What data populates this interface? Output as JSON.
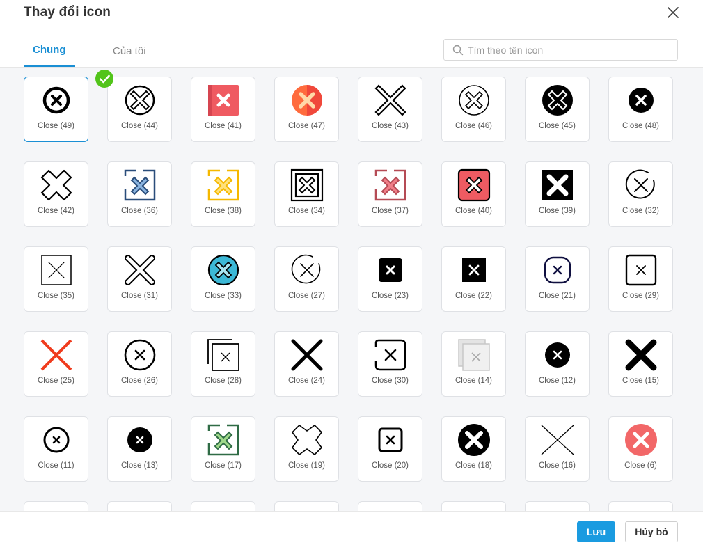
{
  "dialog": {
    "title": "Thay đổi icon"
  },
  "tabs": [
    {
      "label": "Chung"
    },
    {
      "label": "Của tôi"
    }
  ],
  "search": {
    "placeholder": "Tìm theo tên icon",
    "value": ""
  },
  "colors": {
    "accent": "#1a8fd4",
    "success": "#52c41a"
  },
  "icons": [
    {
      "label": "Close (49)",
      "icon": "circle-x-thick-icon",
      "selected": true
    },
    {
      "label": "Close (44)",
      "icon": "circle-x-outline-double-icon"
    },
    {
      "label": "Close (41)",
      "icon": "red-square-x-icon"
    },
    {
      "label": "Close (47)",
      "icon": "orange-circle-x-icon"
    },
    {
      "label": "Close (43)",
      "icon": "outline-x-icon"
    },
    {
      "label": "Close (46)",
      "icon": "circle-x-outline-thin-icon"
    },
    {
      "label": "Close (45)",
      "icon": "black-circle-x-outline-icon"
    },
    {
      "label": "Close (48)",
      "icon": "black-circle-x-icon"
    },
    {
      "label": "Close (42)",
      "icon": "outline-cross-shape-icon"
    },
    {
      "label": "Close (36)",
      "icon": "blue-bracket-square-x-icon"
    },
    {
      "label": "Close (38)",
      "icon": "yellow-bracket-square-x-icon"
    },
    {
      "label": "Close (34)",
      "icon": "double-square-x-icon"
    },
    {
      "label": "Close (37)",
      "icon": "red-bracket-square-x-icon"
    },
    {
      "label": "Close (40)",
      "icon": "red-rounded-square-x-icon"
    },
    {
      "label": "Close (39)",
      "icon": "black-square-x-icon"
    },
    {
      "label": "Close (32)",
      "icon": "open-circle-x-icon"
    },
    {
      "label": "Close (35)",
      "icon": "square-x-thin-icon"
    },
    {
      "label": "Close (31)",
      "icon": "outline-x-rounded-icon"
    },
    {
      "label": "Close (33)",
      "icon": "teal-circle-x-icon"
    },
    {
      "label": "Close (27)",
      "icon": "open-circle-x-thin-icon"
    },
    {
      "label": "Close (23)",
      "icon": "black-rounded-square-x-small-icon"
    },
    {
      "label": "Close (22)",
      "icon": "black-square-x-small-icon"
    },
    {
      "label": "Close (21)",
      "icon": "rounded-square-x-navy-icon"
    },
    {
      "label": "Close (29)",
      "icon": "rounded-square-x-outline-icon"
    },
    {
      "label": "Close (25)",
      "icon": "red-x-icon"
    },
    {
      "label": "Close (26)",
      "icon": "circle-x-outline-icon"
    },
    {
      "label": "Close (28)",
      "icon": "stacked-square-x-icon"
    },
    {
      "label": "Close (24)",
      "icon": "bold-x-icon"
    },
    {
      "label": "Close (30)",
      "icon": "bracket-rounded-square-x-icon"
    },
    {
      "label": "Close (14)",
      "icon": "gray-stacked-square-x-icon"
    },
    {
      "label": "Close (12)",
      "icon": "black-circle-x-small-icon"
    },
    {
      "label": "Close (15)",
      "icon": "heavy-x-icon"
    },
    {
      "label": "Close (11)",
      "icon": "circle-x-thick-small-icon"
    },
    {
      "label": "Close (13)",
      "icon": "black-circle-x-mini-icon"
    },
    {
      "label": "Close (17)",
      "icon": "green-bracket-square-x-icon"
    },
    {
      "label": "Close (19)",
      "icon": "outline-cross-shape-thin-icon"
    },
    {
      "label": "Close (20)",
      "icon": "square-x-thick-small-icon"
    },
    {
      "label": "Close (18)",
      "icon": "black-circle-x-large-icon"
    },
    {
      "label": "Close (16)",
      "icon": "thin-x-icon"
    },
    {
      "label": "Close (6)",
      "icon": "salmon-circle-x-icon"
    },
    {
      "label": "",
      "icon": "partial-yellow-icon"
    },
    {
      "label": "",
      "icon": "partial-circle-icon"
    },
    {
      "label": "",
      "icon": "partial-circle-icon"
    },
    {
      "label": "",
      "icon": "partial-blue-square-icon"
    },
    {
      "label": "",
      "icon": "partial-black-square-icon"
    },
    {
      "label": "",
      "icon": "partial-red-square-icon"
    },
    {
      "label": "",
      "icon": "partial-dot-icon"
    },
    {
      "label": "",
      "icon": "partial-gray-circle-icon"
    }
  ],
  "footer": {
    "save_label": "Lưu",
    "cancel_label": "Hủy bỏ"
  }
}
